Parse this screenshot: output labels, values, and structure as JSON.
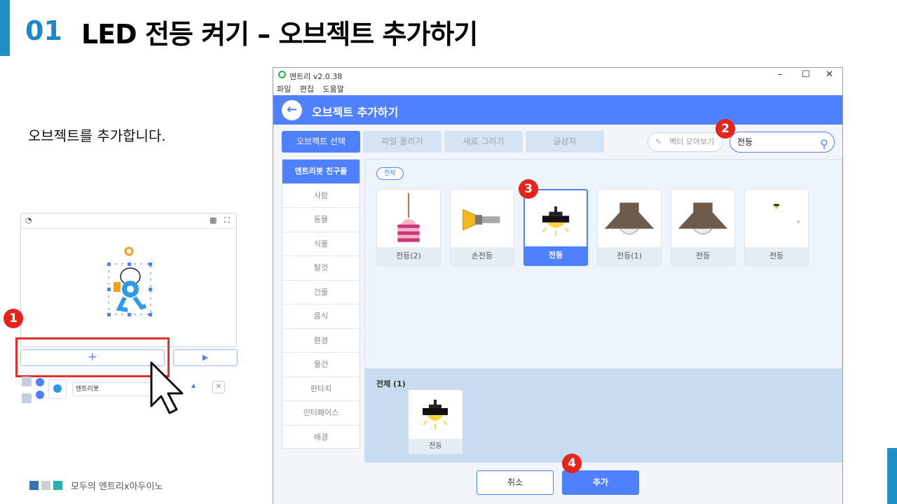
{
  "slide": {
    "number": "01",
    "title": "LED 전등 켜기 – 오브젝트 추가하기",
    "description": "오브젝트를 추가합니다.",
    "footer": "모두의 엔트리x아두이노",
    "colors": {
      "accent": "#1e90c8",
      "badge": "#e8231c",
      "brand": "#4f80ff"
    }
  },
  "steps": {
    "one": "1",
    "two": "2",
    "three": "3",
    "four": "4"
  },
  "stage": {
    "add_label": "+",
    "play_label": "▶",
    "object_name": "엔트리봇"
  },
  "window": {
    "title": "엔트리 v2.0.38",
    "menu": [
      "파일",
      "편집",
      "도움말"
    ],
    "controls": {
      "minimize": "–",
      "maximize": "☐",
      "close": "✕"
    }
  },
  "dialog": {
    "title": "오브젝트 추가하기",
    "back_icon": "←",
    "tabs": [
      "오브젝트 선택",
      "파일 올리기",
      "새로 그리기",
      "글상자"
    ],
    "vector_label": "벡터 모아보기",
    "search_value": "전등",
    "categories": [
      "엔트리봇 친구들",
      "사람",
      "동물",
      "식물",
      "탈것",
      "건물",
      "음식",
      "환경",
      "물건",
      "판타지",
      "인터페이스",
      "배경"
    ],
    "filter_pill": "전체",
    "objects": [
      "전등(2)",
      "손전등",
      "전등",
      "전등(1)",
      "전등",
      "전등"
    ],
    "selected_index": 2,
    "selected_title": "전체 (1)",
    "selected_objects": [
      "전등"
    ],
    "cancel_label": "취소",
    "add_label": "추가"
  }
}
